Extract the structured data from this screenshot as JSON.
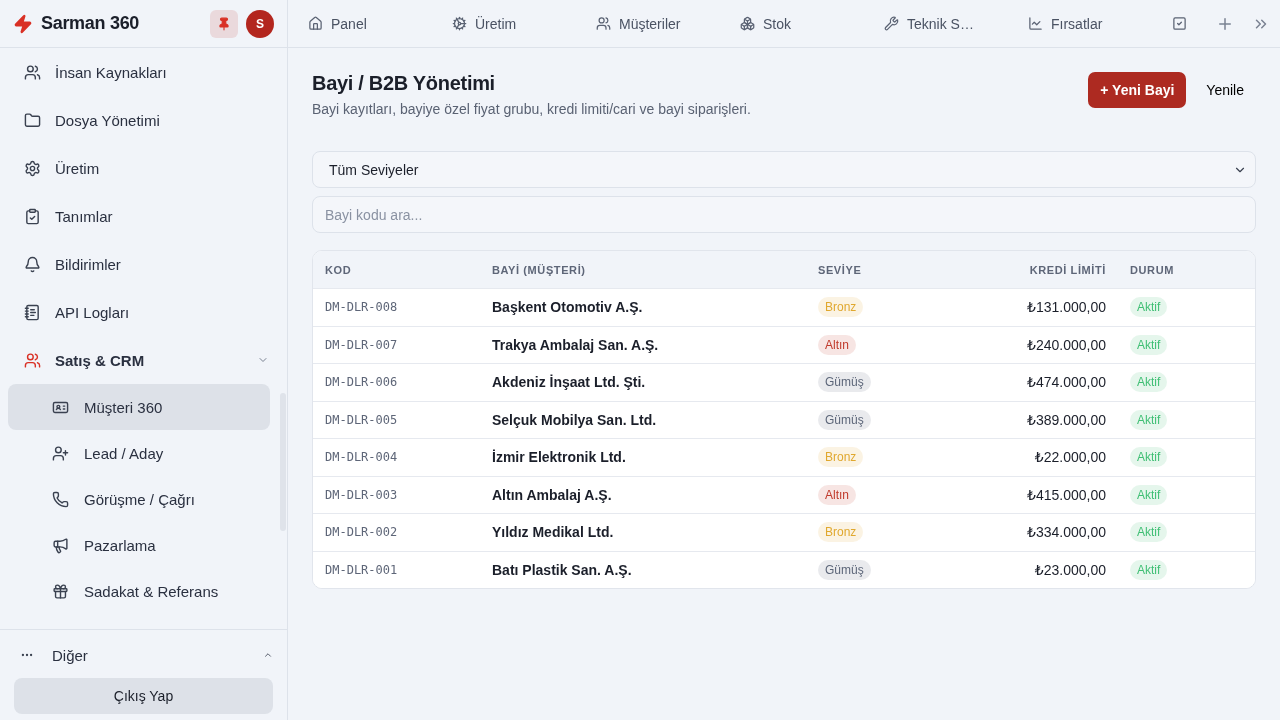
{
  "brand": {
    "name": "Sarman 360",
    "avatar": "S"
  },
  "sidebar": {
    "items": [
      {
        "label": "İnsan Kaynakları",
        "selected": false
      },
      {
        "label": "Dosya Yönetimi",
        "selected": false
      },
      {
        "label": "Üretim",
        "selected": false
      },
      {
        "label": "Tanımlar",
        "selected": false
      },
      {
        "label": "Bildirimler",
        "selected": false
      },
      {
        "label": "API Logları",
        "selected": false
      },
      {
        "label": "Satış & CRM",
        "selected": false,
        "expanded": true,
        "children": [
          {
            "label": "Müşteri 360",
            "selected": true
          },
          {
            "label": "Lead / Aday",
            "selected": false
          },
          {
            "label": "Görüşme / Çağrı",
            "selected": false
          },
          {
            "label": "Pazarlama",
            "selected": false
          },
          {
            "label": "Sadakat & Referans",
            "selected": false
          }
        ]
      }
    ],
    "other": {
      "label": "Diğer",
      "expanded": false
    },
    "logout": "Çıkış Yap"
  },
  "tabs": [
    {
      "label": "Panel"
    },
    {
      "label": "Üretim"
    },
    {
      "label": "Müşteriler"
    },
    {
      "label": "Stok"
    },
    {
      "label": "Teknik S…"
    },
    {
      "label": "Fırsatlar"
    }
  ],
  "page": {
    "title": "Bayi / B2B Yönetimi",
    "subtitle": "Bayi kayıtları, bayiye özel fiyat grubu, kredi limiti/cari ve bayi siparişleri.",
    "new_button": "+ Yeni Bayi",
    "refresh_button": "Yenile"
  },
  "filter": {
    "value": "Tüm Seviyeler"
  },
  "search": {
    "placeholder": "Bayi kodu ara..."
  },
  "table": {
    "columns": [
      "KOD",
      "BAYİ (MÜŞTERİ)",
      "SEVİYE",
      "KREDİ LİMİTİ",
      "DURUM"
    ],
    "rows": [
      {
        "code": "DM-DLR-008",
        "name": "Başkent Otomotiv A.Ş.",
        "level": {
          "label": "Bronz",
          "color": "#e0a82e"
        },
        "limit": "₺131.000,00",
        "status": {
          "label": "Aktif",
          "color": "#3fbf74"
        }
      },
      {
        "code": "DM-DLR-007",
        "name": "Trakya Ambalaj San. A.Ş.",
        "level": {
          "label": "Altın",
          "color": "#c0392b"
        },
        "limit": "₺240.000,00",
        "status": {
          "label": "Aktif",
          "color": "#3fbf74"
        }
      },
      {
        "code": "DM-DLR-006",
        "name": "Akdeniz İnşaat Ltd. Şti.",
        "level": {
          "label": "Gümüş",
          "color": "#5b6578"
        },
        "limit": "₺474.000,00",
        "status": {
          "label": "Aktif",
          "color": "#3fbf74"
        }
      },
      {
        "code": "DM-DLR-005",
        "name": "Selçuk Mobilya San. Ltd.",
        "level": {
          "label": "Gümüş",
          "color": "#5b6578"
        },
        "limit": "₺389.000,00",
        "status": {
          "label": "Aktif",
          "color": "#3fbf74"
        }
      },
      {
        "code": "DM-DLR-004",
        "name": "İzmir Elektronik Ltd.",
        "level": {
          "label": "Bronz",
          "color": "#e0a82e"
        },
        "limit": "₺22.000,00",
        "status": {
          "label": "Aktif",
          "color": "#3fbf74"
        }
      },
      {
        "code": "DM-DLR-003",
        "name": "Altın Ambalaj A.Ş.",
        "level": {
          "label": "Altın",
          "color": "#c0392b"
        },
        "limit": "₺415.000,00",
        "status": {
          "label": "Aktif",
          "color": "#3fbf74"
        }
      },
      {
        "code": "DM-DLR-002",
        "name": "Yıldız Medikal Ltd.",
        "level": {
          "label": "Bronz",
          "color": "#e0a82e"
        },
        "limit": "₺334.000,00",
        "status": {
          "label": "Aktif",
          "color": "#3fbf74"
        }
      },
      {
        "code": "DM-DLR-001",
        "name": "Batı Plastik San. A.Ş.",
        "level": {
          "label": "Gümüş",
          "color": "#5b6578"
        },
        "limit": "₺23.000,00",
        "status": {
          "label": "Aktif",
          "color": "#3fbf74"
        }
      }
    ]
  }
}
